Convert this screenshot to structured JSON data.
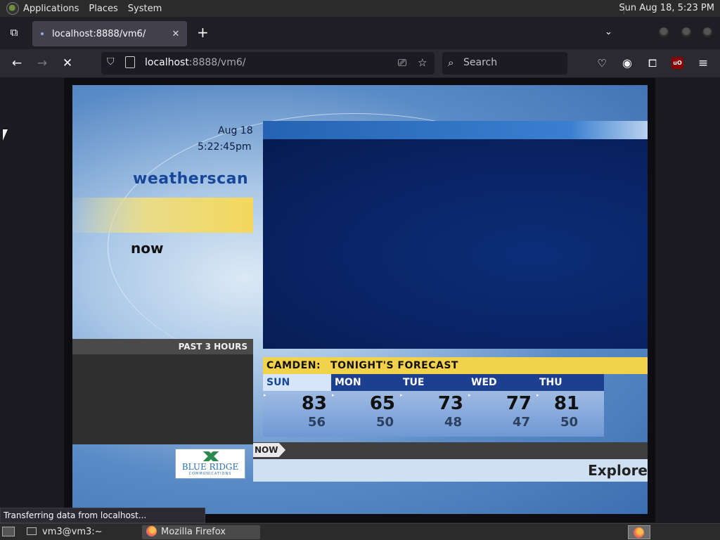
{
  "top_panel": {
    "menus": [
      "Applications",
      "Places",
      "System"
    ],
    "clock": "Sun Aug 18,  5:23 PM"
  },
  "browser": {
    "tab": {
      "title": "localhost:8888/vm6/",
      "close": "✕"
    },
    "new_tab": "+",
    "tab_list": "⌄",
    "url_host": "localhost",
    "url_path": ":8888/vm6/",
    "search_placeholder": "Search",
    "status": "Transferring data from localhost..."
  },
  "weatherscan": {
    "date": "Aug 18",
    "time": "5:22:45pm",
    "logo": "weatherscan",
    "now": "now",
    "past_label": "PAST 3 HOURS",
    "location": "CAMDEN:",
    "forecast_title": "TONIGHT'S FORECAST",
    "days": [
      {
        "name": "SUN",
        "hi": "83",
        "lo": "56"
      },
      {
        "name": "MON",
        "hi": "65",
        "lo": "50"
      },
      {
        "name": "TUE",
        "hi": "73",
        "lo": "48"
      },
      {
        "name": "WED",
        "hi": "77",
        "lo": "47"
      },
      {
        "name": "THU",
        "hi": "81",
        "lo": "50"
      }
    ],
    "ticker_tag": "NOW",
    "explore": "Explore",
    "sponsor_name": "BLUE RIDGE",
    "sponsor_sub": "COMMUNICATIONS"
  },
  "taskbar": {
    "items": [
      "vm3@vm3:~",
      "Mozilla Firefox"
    ]
  }
}
